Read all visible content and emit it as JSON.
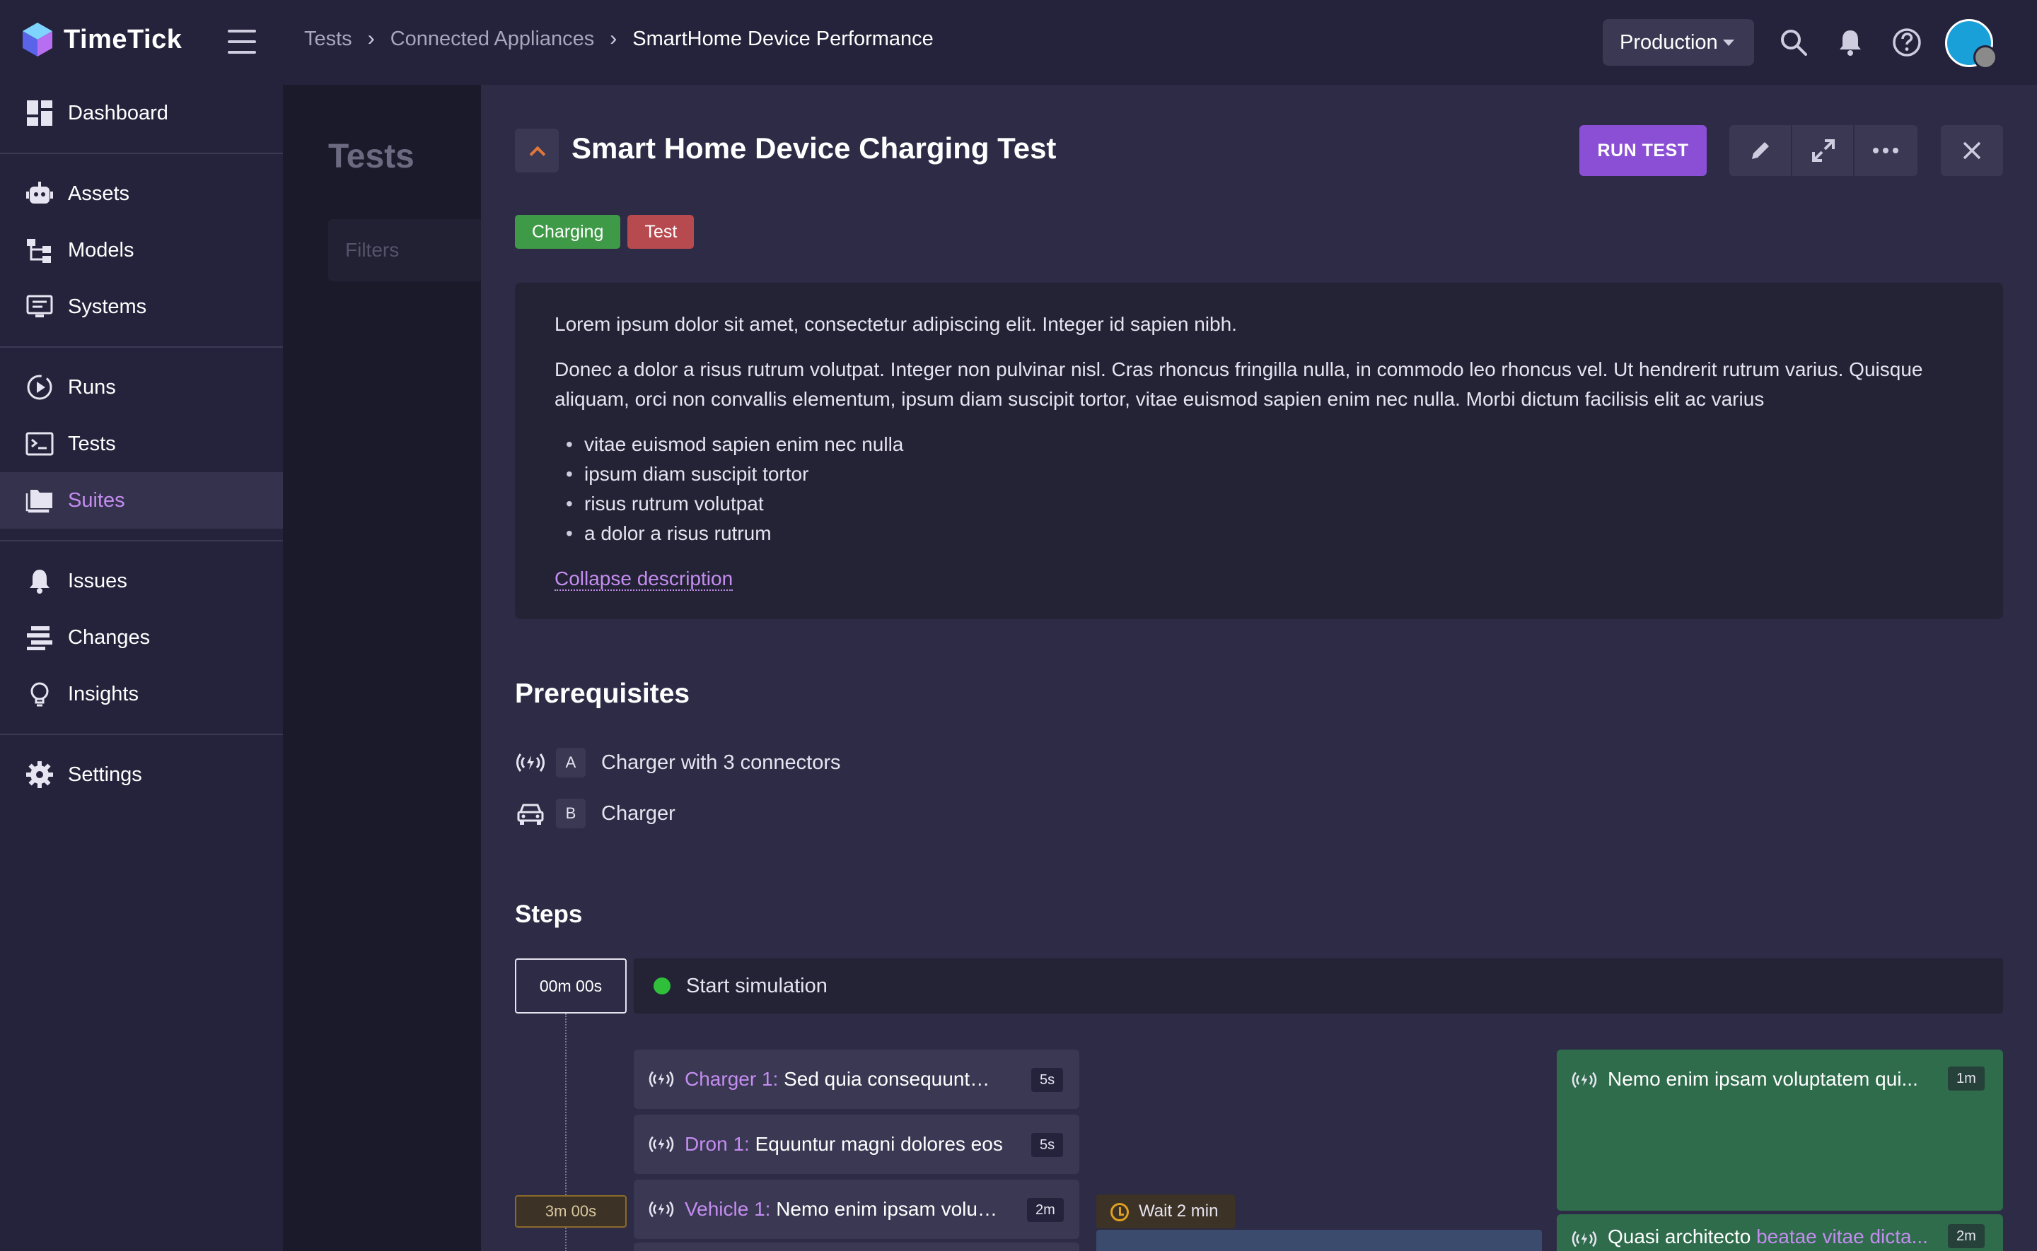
{
  "app": {
    "name": "TimeTick"
  },
  "breadcrumb": {
    "items": [
      "Tests",
      "Connected Appliances"
    ],
    "current": "SmartHome Device Performance"
  },
  "header": {
    "environment": "Production"
  },
  "sidebar": {
    "items": [
      {
        "label": "Dashboard",
        "icon": "dashboard-icon"
      },
      {
        "label": "Assets",
        "icon": "robot-icon"
      },
      {
        "label": "Models",
        "icon": "models-icon"
      },
      {
        "label": "Systems",
        "icon": "systems-icon"
      },
      {
        "label": "Runs",
        "icon": "runs-icon"
      },
      {
        "label": "Tests",
        "icon": "terminal-icon"
      },
      {
        "label": "Suites",
        "icon": "folder-icon",
        "active": true
      },
      {
        "label": "Issues",
        "icon": "bell-icon"
      },
      {
        "label": "Changes",
        "icon": "changes-icon"
      },
      {
        "label": "Insights",
        "icon": "bulb-icon"
      },
      {
        "label": "Settings",
        "icon": "gear-icon"
      }
    ]
  },
  "list": {
    "title": "Tests",
    "filters_placeholder": "Filters"
  },
  "detail": {
    "title": "Smart Home Device Charging Test",
    "run_label": "RUN TEST",
    "tags": [
      {
        "label": "Charging",
        "color": "#3f9a48"
      },
      {
        "label": "Test",
        "color": "#b64a4f"
      }
    ],
    "description": {
      "p1": "Lorem ipsum dolor sit amet, consectetur adipiscing elit. Integer id sapien nibh.",
      "p2": "Donec a dolor a risus rutrum volutpat. Integer non pulvinar nisl. Cras rhoncus fringilla nulla, in commodo leo rhoncus vel. Ut hendrerit rutrum varius. Quisque aliquam, orci non convallis elementum, ipsum diam suscipit tortor, vitae euismod sapien enim nec nulla. Morbi dictum facilisis elit ac varius",
      "bullets": [
        "vitae euismod sapien enim nec nulla",
        "ipsum diam suscipit tortor",
        "risus rutrum volutpat",
        "a dolor a risus rutrum"
      ],
      "collapse_label": "Collapse description"
    },
    "prerequisites": {
      "heading": "Prerequisites",
      "items": [
        {
          "letter": "A",
          "text": "Charger with 3 connectors",
          "icon": "signal-icon"
        },
        {
          "letter": "B",
          "text": "Charger",
          "icon": "car-icon"
        }
      ]
    },
    "steps": {
      "heading": "Steps",
      "start_time": "00m 00s",
      "start_label": "Start simulation",
      "marker_time": "3m 00s",
      "wait_label": "Wait 2 min",
      "cards": [
        {
          "ref": "Charger 1:",
          "text": "Sed quia consequuntur...",
          "duration": "5s"
        },
        {
          "ref": "Dron 1:",
          "text": "Equuntur magni dolores eos",
          "duration": "5s"
        },
        {
          "ref": "Vehicle 1:",
          "text": "Nemo enim ipsam volup...",
          "duration": "2m"
        }
      ],
      "right_cards": [
        {
          "text": "Nemo enim ipsam voluptatem qui...",
          "duration": "1m"
        },
        {
          "text": "Quasi architecto ",
          "ref": "beatae vitae dicta...",
          "duration": "2m"
        }
      ]
    }
  },
  "colors": {
    "accent": "#c48df0",
    "run_button": "#8b4fd6",
    "success": "#2fbf3a"
  }
}
